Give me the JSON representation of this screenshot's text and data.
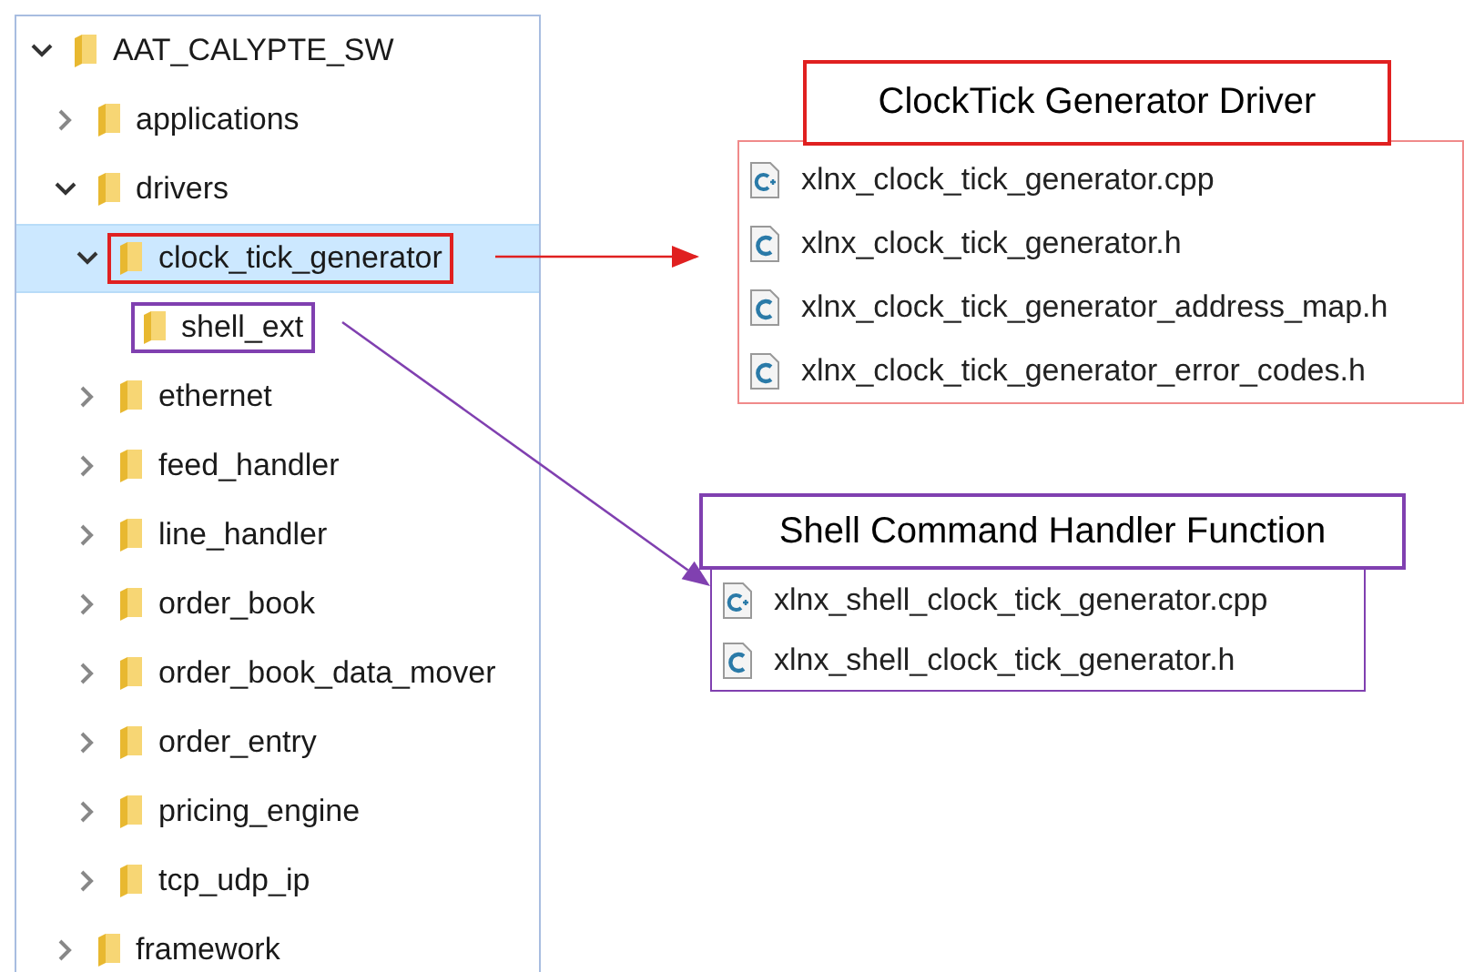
{
  "tree": [
    {
      "label": "AAT_CALYPTE_SW",
      "kind": "branch",
      "expanded": true,
      "selected": false,
      "children": [
        {
          "label": "applications",
          "kind": "branch",
          "expanded": false,
          "selected": false
        },
        {
          "label": "drivers",
          "kind": "branch",
          "expanded": true,
          "selected": false,
          "children": [
            {
              "label": "clock_tick_generator",
              "kind": "branch",
              "expanded": true,
              "selected": true,
              "color": "#e02020",
              "children": [
                {
                  "label": "shell_ext",
                  "kind": "leaf",
                  "selected": false,
                  "color": "#8040b0"
                }
              ]
            },
            {
              "label": "ethernet",
              "kind": "branch",
              "expanded": false,
              "selected": false
            },
            {
              "label": "feed_handler",
              "kind": "branch",
              "expanded": false,
              "selected": false
            },
            {
              "label": "line_handler",
              "kind": "branch",
              "expanded": false,
              "selected": false
            },
            {
              "label": "order_book",
              "kind": "branch",
              "expanded": false,
              "selected": false
            },
            {
              "label": "order_book_data_mover",
              "kind": "branch",
              "expanded": false,
              "selected": false
            },
            {
              "label": "order_entry",
              "kind": "branch",
              "expanded": false,
              "selected": false
            },
            {
              "label": "pricing_engine",
              "kind": "branch",
              "expanded": false,
              "selected": false
            },
            {
              "label": "tcp_udp_ip",
              "kind": "branch",
              "expanded": false,
              "selected": false
            }
          ]
        },
        {
          "label": "framework",
          "kind": "branch",
          "expanded": false,
          "selected": false
        }
      ]
    }
  ],
  "callouts": [
    {
      "title": "ClockTick Generator Driver",
      "color": "#e02020",
      "files": [
        {
          "name": "xlnx_clock_tick_generator.cpp",
          "kind": "cpp"
        },
        {
          "name": "xlnx_clock_tick_generator.h",
          "kind": "h"
        },
        {
          "name": "xlnx_clock_tick_generator_address_map.h",
          "kind": "h"
        },
        {
          "name": "xlnx_clock_tick_generator_error_codes.h",
          "kind": "h"
        }
      ]
    },
    {
      "title": "Shell Command Handler Function",
      "color": "#8040b0",
      "files": [
        {
          "name": "xlnx_shell_clock_tick_generator.cpp",
          "kind": "cpp"
        },
        {
          "name": "xlnx_shell_clock_tick_generator.h",
          "kind": "h"
        }
      ]
    }
  ]
}
